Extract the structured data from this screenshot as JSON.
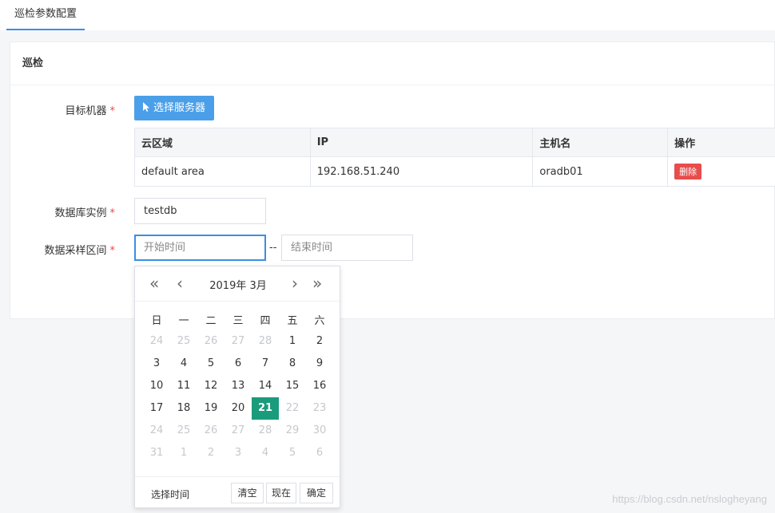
{
  "tab": {
    "title": "巡检参数配置"
  },
  "card": {
    "title": "巡检"
  },
  "form": {
    "target_label": "目标机器",
    "db_label": "数据库实例",
    "range_label": "数据采样区间",
    "required_mark": "*",
    "select_button": "选择服务器",
    "db_value": "testdb",
    "start_placeholder": "开始时间",
    "end_placeholder": "结束时间",
    "range_separator": "--"
  },
  "table": {
    "headers": [
      "云区域",
      "IP",
      "主机名",
      "操作"
    ],
    "row": {
      "area": "default area",
      "ip": "192.168.51.240",
      "host": "oradb01",
      "delete": "删除"
    }
  },
  "picker": {
    "prev_year": "«",
    "prev_month": "‹",
    "title": "2019年  3月",
    "next_month": "›",
    "next_year": "»",
    "weekdays": [
      "日",
      "一",
      "二",
      "三",
      "四",
      "五",
      "六"
    ],
    "weeks": [
      [
        "24",
        "25",
        "26",
        "27",
        "28",
        "1",
        "2"
      ],
      [
        "3",
        "4",
        "5",
        "6",
        "7",
        "8",
        "9"
      ],
      [
        "10",
        "11",
        "12",
        "13",
        "14",
        "15",
        "16"
      ],
      [
        "17",
        "18",
        "19",
        "20",
        "21",
        "22",
        "23"
      ],
      [
        "24",
        "25",
        "26",
        "27",
        "28",
        "29",
        "30"
      ],
      [
        "31",
        "1",
        "2",
        "3",
        "4",
        "5",
        "6"
      ]
    ],
    "selected": "21",
    "foot_label": "选择时间",
    "btn_clear": "清空",
    "btn_now": "现在",
    "btn_confirm": "确定"
  },
  "watermark": "https://blog.csdn.net/nslogheyang",
  "colors": {
    "primary": "#4a9fe8",
    "danger": "#e84c4c",
    "selected": "#1a9b7c",
    "focus": "#3a8ee6"
  }
}
